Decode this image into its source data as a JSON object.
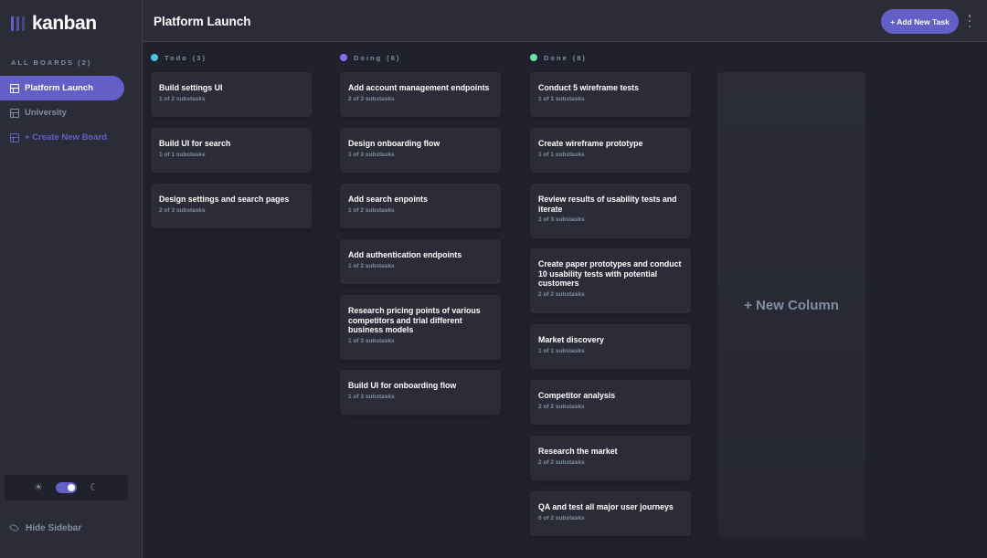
{
  "app": {
    "logo_text": "kanban"
  },
  "colors": {
    "accent": "#635fc7",
    "todo": "#49c4e5",
    "doing": "#8471f2",
    "done": "#67e2ae"
  },
  "sidebar": {
    "heading": "ALL BOARDS (2)",
    "boards": [
      {
        "label": "Platform Launch",
        "active": true
      },
      {
        "label": "University",
        "active": false
      }
    ],
    "create_label": "+ Create New Board",
    "hide_label": "Hide Sidebar",
    "theme": {
      "dark": true
    }
  },
  "header": {
    "title": "Platform Launch",
    "add_task_label": "+ Add New Task"
  },
  "columns": [
    {
      "name": "Todo",
      "count": "(3)",
      "cards": [
        {
          "title": "Build settings UI",
          "subtasks": "1 of 2 substasks"
        },
        {
          "title": "Build UI for search",
          "subtasks": "1 of 1 substasks"
        },
        {
          "title": "Design settings and search pages",
          "subtasks": "2 of 3 substasks"
        }
      ]
    },
    {
      "name": "Doing",
      "count": "(6)",
      "cards": [
        {
          "title": "Add account management endpoints",
          "subtasks": "2 of 3 substasks"
        },
        {
          "title": "Design onboarding flow",
          "subtasks": "1 of 3 substasks"
        },
        {
          "title": "Add search enpoints",
          "subtasks": "1 of 2 substasks"
        },
        {
          "title": "Add authentication endpoints",
          "subtasks": "1 of 2 substasks"
        },
        {
          "title": "Research pricing points of various competitors and trial different business models",
          "subtasks": "1 of 3 substasks"
        },
        {
          "title": "Build UI for onboarding flow",
          "subtasks": "1 of 3 substasks"
        }
      ]
    },
    {
      "name": "Done",
      "count": "(8)",
      "cards": [
        {
          "title": "Conduct 5 wireframe tests",
          "subtasks": "1 of 1 substasks"
        },
        {
          "title": "Create wireframe prototype",
          "subtasks": "1 of 1 substasks"
        },
        {
          "title": "Review results of usability tests and iterate",
          "subtasks": "3 of 3 substasks"
        },
        {
          "title": "Create paper prototypes and conduct 10 usability tests with potential customers",
          "subtasks": "2 of 2 substasks"
        },
        {
          "title": "Market discovery",
          "subtasks": "1 of 1 substasks"
        },
        {
          "title": "Competitor analysis",
          "subtasks": "2 of 2 substasks"
        },
        {
          "title": "Research the market",
          "subtasks": "2 of 2 substasks"
        },
        {
          "title": "QA and test all major user journeys",
          "subtasks": "0 of 2 substasks"
        }
      ]
    }
  ],
  "new_column_label": "+ New Column"
}
